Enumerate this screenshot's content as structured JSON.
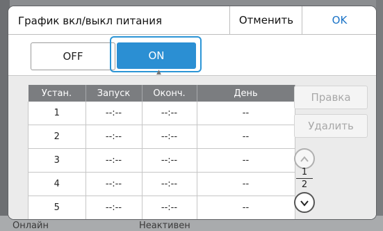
{
  "background": {
    "bottom_left_text": "Онлайн",
    "bottom_middle_text": "Неактивен"
  },
  "dialog": {
    "title": "График вкл/выкл питания",
    "cancel_label": "Отменить",
    "ok_label": "OK"
  },
  "toggle": {
    "off_label": "OFF",
    "on_label": "ON",
    "selected": "ON"
  },
  "table": {
    "columns": [
      "Устан.",
      "Запуск",
      "Оконч.",
      "День"
    ],
    "rows": [
      [
        "1",
        "--:--",
        "--:--",
        "--"
      ],
      [
        "2",
        "--:--",
        "--:--",
        "--"
      ],
      [
        "3",
        "--:--",
        "--:--",
        "--"
      ],
      [
        "4",
        "--:--",
        "--:--",
        "--"
      ],
      [
        "5",
        "--:--",
        "--:--",
        "--"
      ]
    ]
  },
  "side_actions": {
    "edit_label": "Правка",
    "delete_label": "Удалить"
  },
  "pagination": {
    "current": "1",
    "total": "2"
  },
  "colors": {
    "accent": "#2b8fd3",
    "ok_text": "#1a73c7",
    "table_header": "#7b7d80"
  }
}
